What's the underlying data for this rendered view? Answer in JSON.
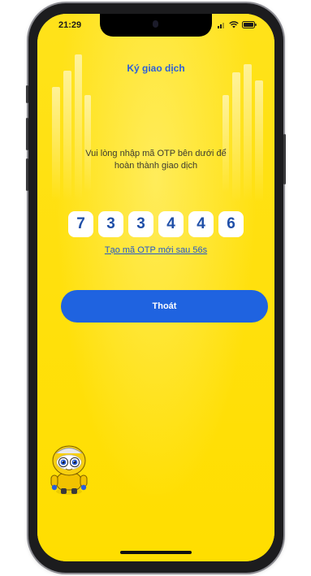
{
  "status_bar": {
    "time": "21:29",
    "icons": [
      "signal-icon",
      "wifi-icon",
      "battery-icon"
    ]
  },
  "header": {
    "title": "Ký giao dịch"
  },
  "otp": {
    "instruction": "Vui lòng nhập mã OTP bên dưới để hoàn thành giao dịch",
    "digits": [
      "7",
      "3",
      "3",
      "4",
      "4",
      "6"
    ],
    "resend_label": "Tạo mã OTP mới sau 56s"
  },
  "actions": {
    "exit_label": "Thoát"
  },
  "colors": {
    "background": "#ffe10a",
    "accent": "#1f63e0",
    "title": "#2b5fd9",
    "digit": "#1f4fa8"
  },
  "mascot": {
    "icon": "robot-mascot-icon"
  }
}
